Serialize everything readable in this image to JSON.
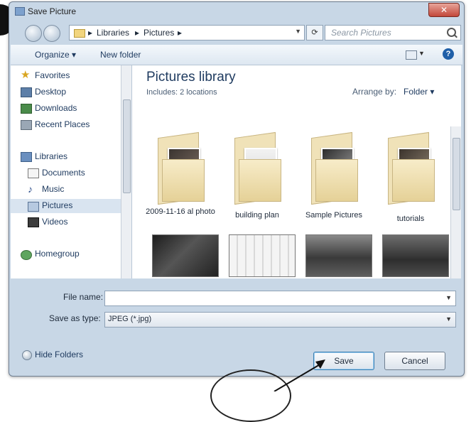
{
  "window": {
    "title": "Save Picture",
    "close_label": "✕"
  },
  "address": {
    "crumbs": [
      "Libraries",
      "Pictures"
    ],
    "separator": "▸"
  },
  "search": {
    "placeholder": "Search Pictures"
  },
  "toolbar": {
    "organize": "Organize ▾",
    "new_folder": "New folder",
    "help": "?"
  },
  "nav": {
    "favorites": "Favorites",
    "desktop": "Desktop",
    "downloads": "Downloads",
    "recent": "Recent Places",
    "libraries": "Libraries",
    "documents": "Documents",
    "music": "Music",
    "pictures": "Pictures",
    "videos": "Videos",
    "homegroup": "Homegroup"
  },
  "library": {
    "title": "Pictures library",
    "includes": "Includes:  2 locations",
    "arrange_by_label": "Arrange by:",
    "arrange_by_value": "Folder ▾"
  },
  "folders": [
    {
      "label": "2009-11-16 al photo"
    },
    {
      "label": "building plan"
    },
    {
      "label": "Sample Pictures"
    },
    {
      "label": "tutorials"
    }
  ],
  "form": {
    "file_name_label": "File name:",
    "file_name_value": "",
    "save_as_type_label": "Save as type:",
    "save_as_type_value": "JPEG (*.jpg)"
  },
  "footer": {
    "hide_folders": "Hide Folders",
    "save": "Save",
    "cancel": "Cancel"
  },
  "colors": {
    "selection": "#3e77c5",
    "window_frame": "#c8d7e6",
    "close": "#c2473a"
  }
}
